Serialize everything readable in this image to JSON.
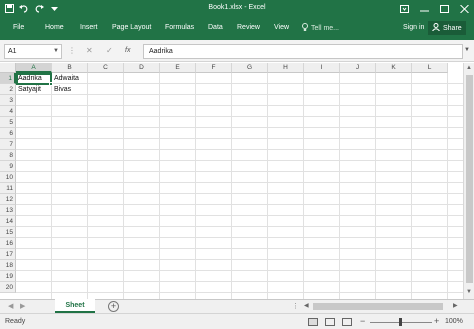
{
  "window": {
    "title": "Book1.xlsx - Excel",
    "controls": [
      "ribbon-display-options-icon",
      "minimize-icon",
      "maximize-icon",
      "close-icon"
    ]
  },
  "quick_access": [
    "save-icon",
    "undo-icon",
    "redo-icon",
    "customize-dropdown-icon"
  ],
  "ribbon": {
    "tabs": [
      "File",
      "Home",
      "Insert",
      "Page Layout",
      "Formulas",
      "Data",
      "Review",
      "View"
    ],
    "tell_me": "Tell me...",
    "sign_in": "Sign in",
    "share": "Share"
  },
  "formula_bar": {
    "name_box": "A1",
    "cancel_glyph": "✕",
    "enter_glyph": "✓",
    "fx_glyph": "fx",
    "content": "Aadrika"
  },
  "grid": {
    "columns": [
      "A",
      "B",
      "C",
      "D",
      "E",
      "F",
      "G",
      "H",
      "I",
      "J",
      "K",
      "L"
    ],
    "rows": [
      "1",
      "2",
      "3",
      "4",
      "5",
      "6",
      "7",
      "8",
      "9",
      "10",
      "11",
      "12",
      "13",
      "14",
      "15",
      "16",
      "17",
      "18",
      "19",
      "20"
    ],
    "cells": [
      {
        "ref": "A1",
        "value": "Aadrika"
      },
      {
        "ref": "B1",
        "value": "Adwaita"
      },
      {
        "ref": "A2",
        "value": "Satyajit"
      },
      {
        "ref": "B2",
        "value": "Bivas"
      }
    ],
    "active_cell": "A1"
  },
  "sheets": {
    "tabs": [
      "Sheet"
    ],
    "active": "Sheet",
    "add_glyph": "+"
  },
  "status_bar": {
    "status": "Ready",
    "zoom": "100%",
    "zoom_minus": "−",
    "zoom_plus": "+"
  },
  "colors": {
    "accent": "#217346",
    "share_bg": "#1a5c38"
  }
}
